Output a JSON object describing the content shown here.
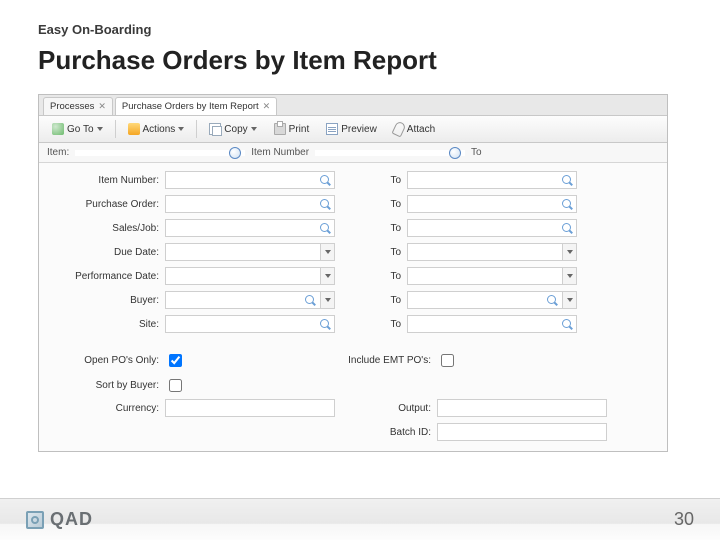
{
  "slide": {
    "eyebrow": "Easy On-Boarding",
    "title": "Purchase Orders by Item Report"
  },
  "tabs": {
    "t0": "Processes",
    "t1": "Purchase Orders by Item Report"
  },
  "toolbar": {
    "goto": "Go To",
    "actions": "Actions",
    "copy": "Copy",
    "print": "Print",
    "preview": "Preview",
    "attach": "Attach"
  },
  "filterbar": {
    "item_label": "Item:",
    "item_value": "",
    "col1": "Item Number",
    "col2": "To"
  },
  "form": {
    "item_number": "Item Number:",
    "purchase_order": "Purchase Order:",
    "sales_job": "Sales/Job:",
    "due_date": "Due Date:",
    "performance_date": "Performance Date:",
    "buyer": "Buyer:",
    "site": "Site:",
    "to": "To"
  },
  "checks": {
    "open_po_only": "Open PO's Only:",
    "include_emt": "Include EMT PO's:",
    "sort_by_buyer": "Sort by Buyer:"
  },
  "out": {
    "currency": "Currency:",
    "output": "Output:",
    "batch_id": "Batch ID:"
  },
  "footer": {
    "brand": "QAD",
    "page": "30"
  }
}
